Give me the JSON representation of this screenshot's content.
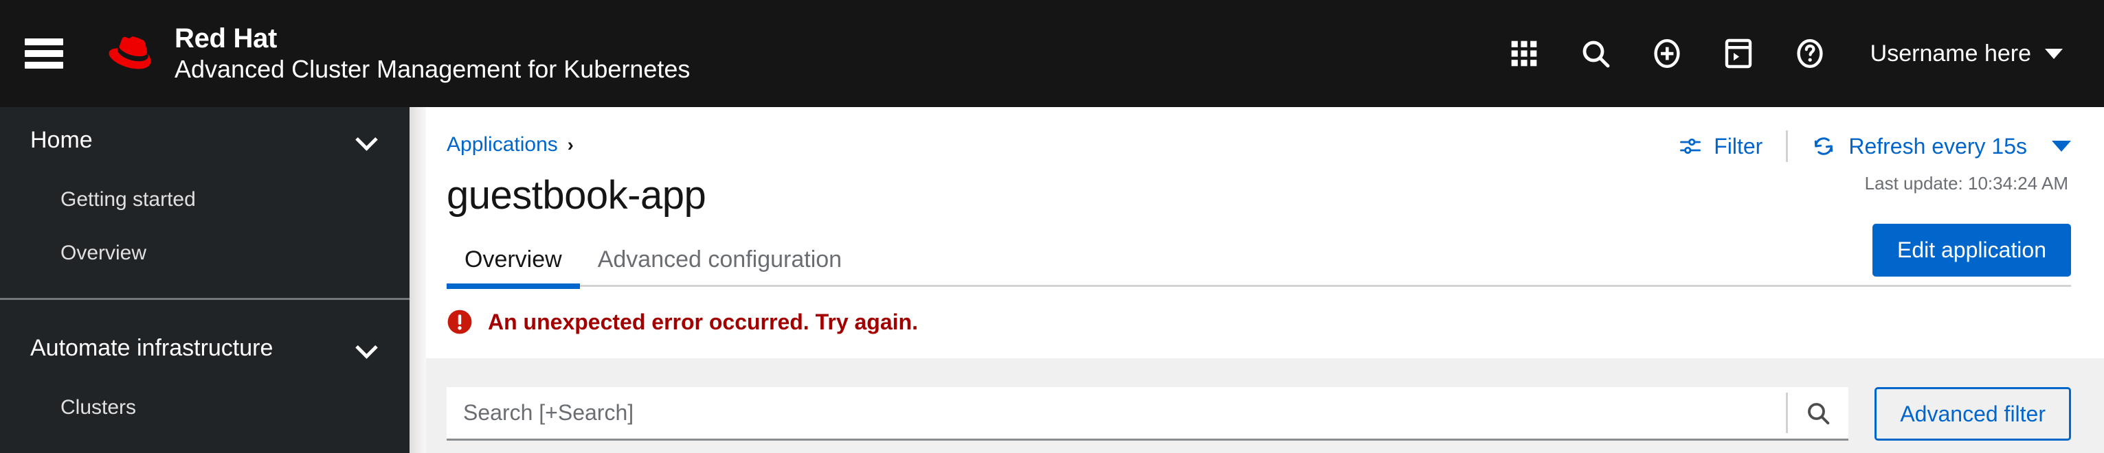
{
  "masthead": {
    "menu_toggle": "Global navigation toggle",
    "brand_line1": "Red Hat",
    "brand_line2": "Advanced Cluster Management for Kubernetes",
    "tools": [
      {
        "name": "application-launcher-icon",
        "label": "Application launcher"
      },
      {
        "name": "search-icon",
        "label": "Search"
      },
      {
        "name": "plus-circle-icon",
        "label": "Add"
      },
      {
        "name": "console-icon",
        "label": "Web terminal"
      },
      {
        "name": "help-icon",
        "label": "Help"
      }
    ],
    "username": "Username here"
  },
  "sidebar": {
    "groups": [
      {
        "label": "Home",
        "expanded": true,
        "items": [
          {
            "label": "Getting started"
          },
          {
            "label": "Overview"
          }
        ]
      },
      {
        "label": "Automate infrastructure",
        "expanded": true,
        "items": [
          {
            "label": "Clusters"
          }
        ]
      }
    ]
  },
  "page": {
    "breadcrumb": {
      "parent": "Applications",
      "separator": "›"
    },
    "title": "guestbook-app",
    "tabs": [
      {
        "label": "Overview",
        "active": true
      },
      {
        "label": "Advanced configuration",
        "active": false
      }
    ],
    "edit_button": "Edit application",
    "toolbar": {
      "filter_label": "Filter",
      "refresh_label": "Refresh every 15s",
      "last_update": "Last update: 10:34:24 AM"
    },
    "alert": {
      "text": "An unexpected error occurred. Try again.",
      "severity": "danger"
    },
    "search": {
      "value": "",
      "placeholder": "Search [+Search]",
      "submit_label": "Search",
      "advanced_filter_label": "Advanced filter"
    }
  },
  "colors": {
    "masthead_bg": "#151515",
    "sidebar_bg": "#212427",
    "accent_blue": "#0066cc",
    "danger_red": "#c9190b",
    "danger_text": "#a30000",
    "band_gray": "#f0f0f0",
    "brand_red": "#ee0000"
  }
}
